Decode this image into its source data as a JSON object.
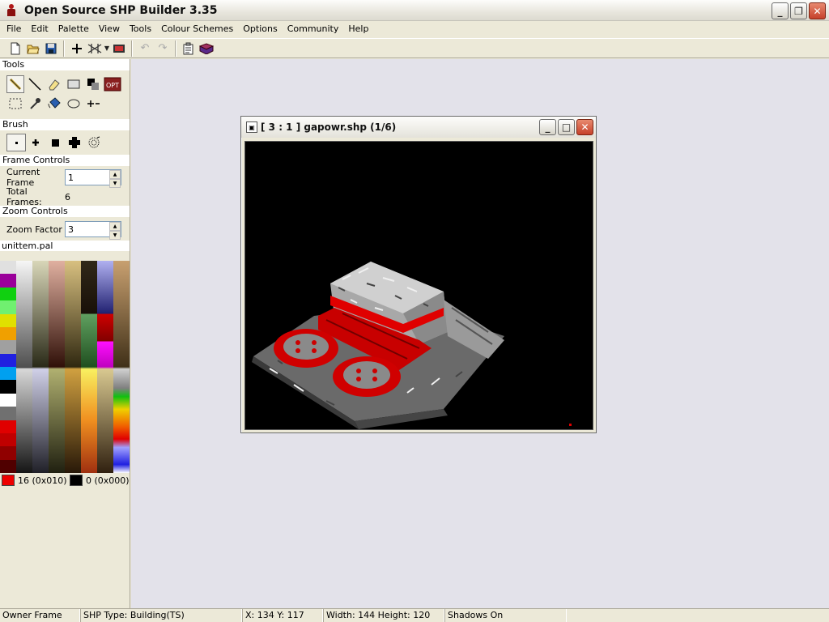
{
  "window": {
    "title": "Open Source SHP Builder 3.35",
    "buttons": {
      "minimize": "_",
      "restore": "❐",
      "close": "✕"
    }
  },
  "menu": [
    "File",
    "Edit",
    "Palette",
    "View",
    "Tools",
    "Colour Schemes",
    "Options",
    "Community",
    "Help"
  ],
  "toolbar": {
    "icons": [
      "new-icon",
      "open-icon",
      "save-icon",
      "crosshair-icon",
      "grid-icon",
      "preview-icon",
      "undo-icon",
      "redo-icon",
      "properties-icon",
      "book-icon"
    ]
  },
  "panel": {
    "tools_header": "Tools",
    "tools_opt_label": "OPT",
    "brush_header": "Brush",
    "frame_header": "Frame Controls",
    "current_frame_label": "Current Frame",
    "current_frame_value": "1",
    "total_frames_label": "Total Frames:",
    "total_frames_value": "6",
    "zoom_header": "Zoom Controls",
    "zoom_label": "Zoom Factor",
    "zoom_value": "3",
    "palette_name": "unittem.pal",
    "primary_color": {
      "label": "16 (0x010)",
      "hex": "#ee0000"
    },
    "secondary_color": {
      "label": "0 (0x000)",
      "hex": "#000000"
    }
  },
  "child": {
    "title": "[ 3 : 1 ] gapowr.shp (1/6)",
    "buttons": {
      "minimize": "_",
      "maximize": "□",
      "close": "✕"
    }
  },
  "status": {
    "owner": "Owner Frame",
    "type": "SHP Type: Building(TS)",
    "coords": "X: 134 Y: 117",
    "size": "Width: 144 Height: 120",
    "shadows": "Shadows On"
  },
  "colors": {
    "accent_red": "#d40000",
    "mdi_bg": "#e3e2ea",
    "chrome": "#ece9d8"
  }
}
